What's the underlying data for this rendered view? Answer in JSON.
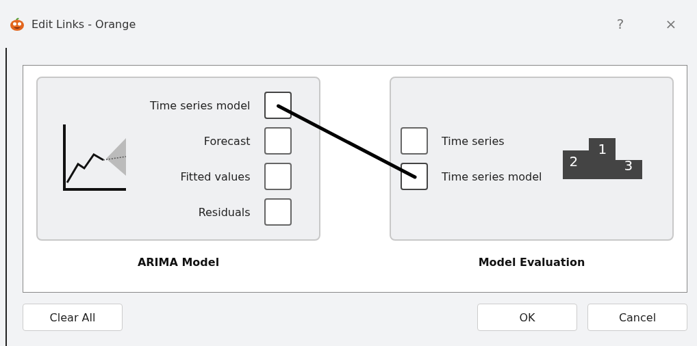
{
  "window": {
    "title": "Edit Links - Orange",
    "help": "?",
    "close": "×"
  },
  "nodes": [
    {
      "title": "ARIMA Model",
      "kind": "source",
      "channels": [
        {
          "name": "Time series model",
          "linked": true
        },
        {
          "name": "Forecast",
          "linked": false
        },
        {
          "name": "Fitted values",
          "linked": false
        },
        {
          "name": "Residuals",
          "linked": false
        }
      ]
    },
    {
      "title": "Model Evaluation",
      "kind": "sink",
      "podium": [
        "2",
        "1",
        "3"
      ],
      "channels": [
        {
          "name": "Time series",
          "linked": false
        },
        {
          "name": "Time series model",
          "linked": true
        }
      ]
    }
  ],
  "buttons": [
    {
      "label": "Clear All",
      "kind": "left"
    },
    {
      "label": "OK",
      "kind": "right"
    },
    {
      "label": "Cancel",
      "kind": "right"
    }
  ]
}
